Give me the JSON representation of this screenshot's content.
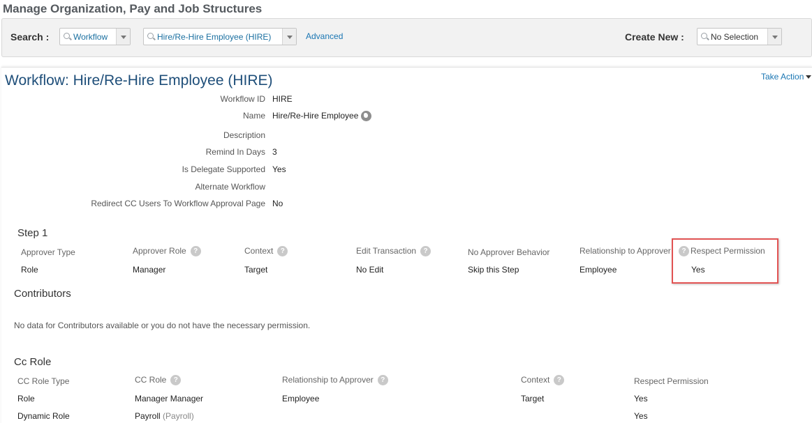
{
  "page": {
    "title": "Manage Organization, Pay and Job Structures"
  },
  "search": {
    "label": "Search :",
    "type_value": "Workflow",
    "item_value": "Hire/Re-Hire Employee (HIRE)",
    "advanced_label": "Advanced"
  },
  "create_new": {
    "label": "Create New :",
    "value": "No Selection"
  },
  "workflow": {
    "title": "Workflow: Hire/Re-Hire Employee (HIRE)",
    "take_action_label": "Take Action",
    "fields": [
      {
        "label": "Workflow ID",
        "value": "HIRE"
      },
      {
        "label": "Name",
        "value": "Hire/Re-Hire Employee"
      },
      {
        "label": "Description",
        "value": ""
      },
      {
        "label": "Remind In Days",
        "value": "3"
      },
      {
        "label": "Is Delegate Supported",
        "value": "Yes"
      },
      {
        "label": "Alternate Workflow",
        "value": ""
      },
      {
        "label": "Redirect CC Users To Workflow Approval Page",
        "value": "No"
      }
    ]
  },
  "step1": {
    "title": "Step 1",
    "headers": [
      "Approver Type",
      "Approver Role",
      "Context",
      "Edit Transaction",
      "No Approver Behavior",
      "Relationship to Approver",
      "Respect Permission"
    ],
    "row": [
      "Role",
      "Manager",
      "Target",
      "No Edit",
      "Skip this Step",
      "Employee",
      "Yes"
    ]
  },
  "contributors": {
    "title": "Contributors",
    "empty_message": "No data for Contributors available or you do not have the necessary permission."
  },
  "cc_role": {
    "title": "Cc Role",
    "headers": [
      "CC Role Type",
      "CC Role",
      "Relationship to Approver",
      "Context",
      "Respect Permission"
    ],
    "rows": [
      {
        "type": "Role",
        "role": "Manager Manager",
        "role_suffix": "",
        "relationship": "Employee",
        "context": "Target",
        "respect": "Yes"
      },
      {
        "type": "Dynamic Role",
        "role": "Payroll",
        "role_suffix": "(Payroll)",
        "relationship": "",
        "context": "",
        "respect": "Yes"
      }
    ]
  }
}
